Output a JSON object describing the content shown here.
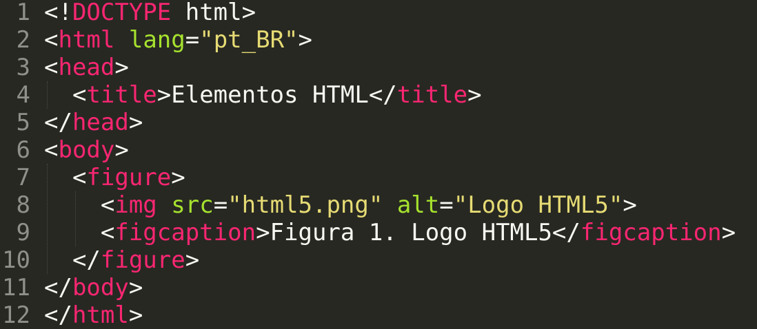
{
  "editor": {
    "lines": [
      {
        "number": "1",
        "tokens": [
          {
            "t": "<!",
            "c": "punct"
          },
          {
            "t": "DOCTYPE",
            "c": "tag"
          },
          {
            "t": " html>",
            "c": "punct"
          }
        ]
      },
      {
        "number": "2",
        "tokens": [
          {
            "t": "<",
            "c": "punct"
          },
          {
            "t": "html",
            "c": "tag"
          },
          {
            "t": " ",
            "c": "punct"
          },
          {
            "t": "lang",
            "c": "attr"
          },
          {
            "t": "=",
            "c": "punct"
          },
          {
            "t": "\"pt_BR\"",
            "c": "str"
          },
          {
            "t": ">",
            "c": "punct"
          }
        ]
      },
      {
        "number": "3",
        "tokens": [
          {
            "t": "<",
            "c": "punct"
          },
          {
            "t": "head",
            "c": "tag"
          },
          {
            "t": ">",
            "c": "punct"
          }
        ]
      },
      {
        "number": "4",
        "tokens": [
          {
            "t": "  <",
            "c": "punct"
          },
          {
            "t": "title",
            "c": "tag"
          },
          {
            "t": ">Elementos HTML</",
            "c": "txt"
          },
          {
            "t": "title",
            "c": "tag"
          },
          {
            "t": ">",
            "c": "punct"
          }
        ]
      },
      {
        "number": "5",
        "tokens": [
          {
            "t": "</",
            "c": "punct"
          },
          {
            "t": "head",
            "c": "tag"
          },
          {
            "t": ">",
            "c": "punct"
          }
        ]
      },
      {
        "number": "6",
        "tokens": [
          {
            "t": "<",
            "c": "punct"
          },
          {
            "t": "body",
            "c": "tag"
          },
          {
            "t": ">",
            "c": "punct"
          }
        ]
      },
      {
        "number": "7",
        "tokens": [
          {
            "t": "  <",
            "c": "punct"
          },
          {
            "t": "figure",
            "c": "tag"
          },
          {
            "t": ">",
            "c": "punct"
          }
        ]
      },
      {
        "number": "8",
        "tokens": [
          {
            "t": "    <",
            "c": "punct"
          },
          {
            "t": "img",
            "c": "tag"
          },
          {
            "t": " ",
            "c": "punct"
          },
          {
            "t": "src",
            "c": "attr"
          },
          {
            "t": "=",
            "c": "punct"
          },
          {
            "t": "\"html5.png\"",
            "c": "str"
          },
          {
            "t": " ",
            "c": "punct"
          },
          {
            "t": "alt",
            "c": "attr"
          },
          {
            "t": "=",
            "c": "punct"
          },
          {
            "t": "\"Logo HTML5\"",
            "c": "str"
          },
          {
            "t": ">",
            "c": "punct"
          }
        ]
      },
      {
        "number": "9",
        "tokens": [
          {
            "t": "    <",
            "c": "punct"
          },
          {
            "t": "figcaption",
            "c": "tag"
          },
          {
            "t": ">Figura 1. Logo HTML5</",
            "c": "txt"
          },
          {
            "t": "figcaption",
            "c": "tag"
          },
          {
            "t": ">",
            "c": "punct"
          }
        ]
      },
      {
        "number": "10",
        "tokens": [
          {
            "t": "  </",
            "c": "punct"
          },
          {
            "t": "figure",
            "c": "tag"
          },
          {
            "t": ">",
            "c": "punct"
          }
        ]
      },
      {
        "number": "11",
        "tokens": [
          {
            "t": "</",
            "c": "punct"
          },
          {
            "t": "body",
            "c": "tag"
          },
          {
            "t": ">",
            "c": "punct"
          }
        ]
      },
      {
        "number": "12",
        "tokens": [
          {
            "t": "</",
            "c": "punct"
          },
          {
            "t": "html",
            "c": "tag"
          },
          {
            "t": ">",
            "c": "punct"
          }
        ]
      }
    ]
  },
  "theme": {
    "background": "#272822",
    "foreground": "#f8f8f2",
    "tag": "#f92672",
    "attribute": "#a6e22e",
    "string": "#e6db74",
    "line_number": "#8f908a"
  }
}
